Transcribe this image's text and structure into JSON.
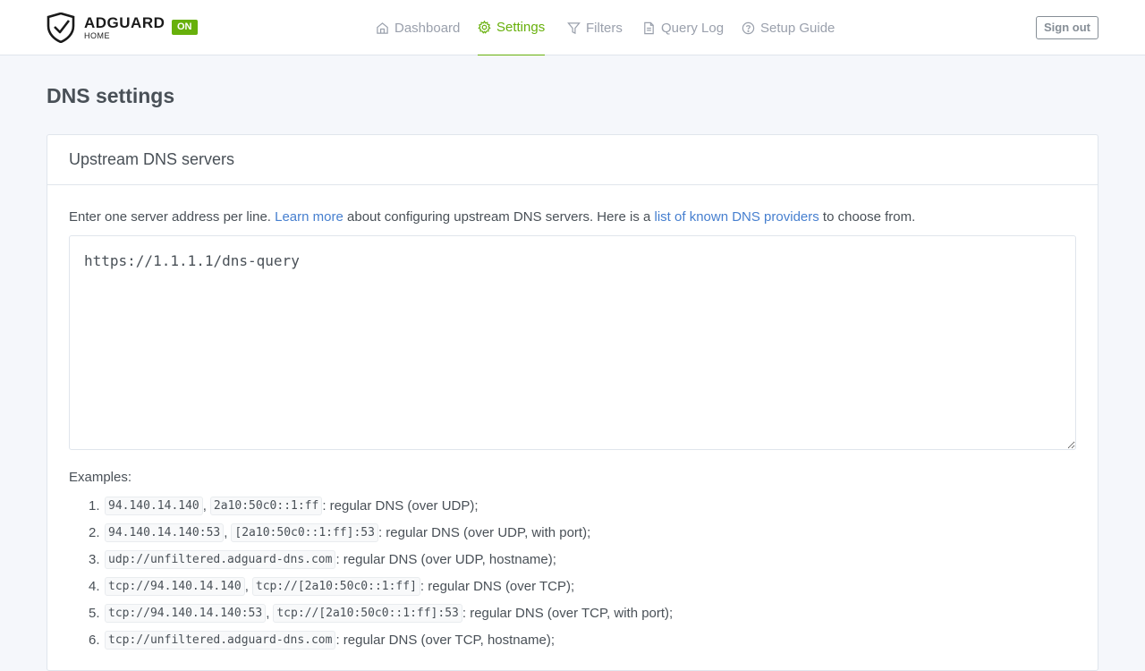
{
  "header": {
    "logo_main": "ADGUARD",
    "logo_sub": "HOME",
    "status_badge": "ON",
    "nav": [
      {
        "label": "Dashboard",
        "icon": "home-icon"
      },
      {
        "label": "Settings",
        "icon": "gear-icon",
        "active": true
      },
      {
        "label": "Filters",
        "icon": "filter-icon"
      },
      {
        "label": "Query Log",
        "icon": "document-icon"
      },
      {
        "label": "Setup Guide",
        "icon": "help-circle-icon"
      }
    ],
    "signout_label": "Sign out"
  },
  "page": {
    "title": "DNS settings"
  },
  "upstream": {
    "title": "Upstream DNS servers",
    "desc_pre": "Enter one server address per line.",
    "learn_more": "Learn more",
    "desc_mid": "about configuring upstream DNS servers. Here is a",
    "providers_link": "list of known DNS providers",
    "desc_post": "to choose from.",
    "textarea_value": "https://1.1.1.1/dns-query",
    "examples_title": "Examples:",
    "examples": [
      {
        "num": "1.",
        "codes": [
          "94.140.14.140",
          "2a10:50c0::1:ff"
        ],
        "text": ": regular DNS (over UDP);"
      },
      {
        "num": "2.",
        "codes": [
          "94.140.14.140:53",
          "[2a10:50c0::1:ff]:53"
        ],
        "text": ": regular DNS (over UDP, with port);"
      },
      {
        "num": "3.",
        "codes": [
          "udp://unfiltered.adguard-dns.com"
        ],
        "text": ": regular DNS (over UDP, hostname);"
      },
      {
        "num": "4.",
        "codes": [
          "tcp://94.140.14.140",
          "tcp://[2a10:50c0::1:ff]"
        ],
        "text": ": regular DNS (over TCP);"
      },
      {
        "num": "5.",
        "codes": [
          "tcp://94.140.14.140:53",
          "tcp://[2a10:50c0::1:ff]:53"
        ],
        "text": ": regular DNS (over TCP, with port);"
      },
      {
        "num": "6.",
        "codes": [
          "tcp://unfiltered.adguard-dns.com"
        ],
        "text": ": regular DNS (over TCP, hostname);"
      }
    ]
  },
  "colors": {
    "accent": "#67b00b",
    "link": "#467fcf",
    "nav_inactive": "#9aa0ac",
    "background": "#f5f7fb"
  }
}
